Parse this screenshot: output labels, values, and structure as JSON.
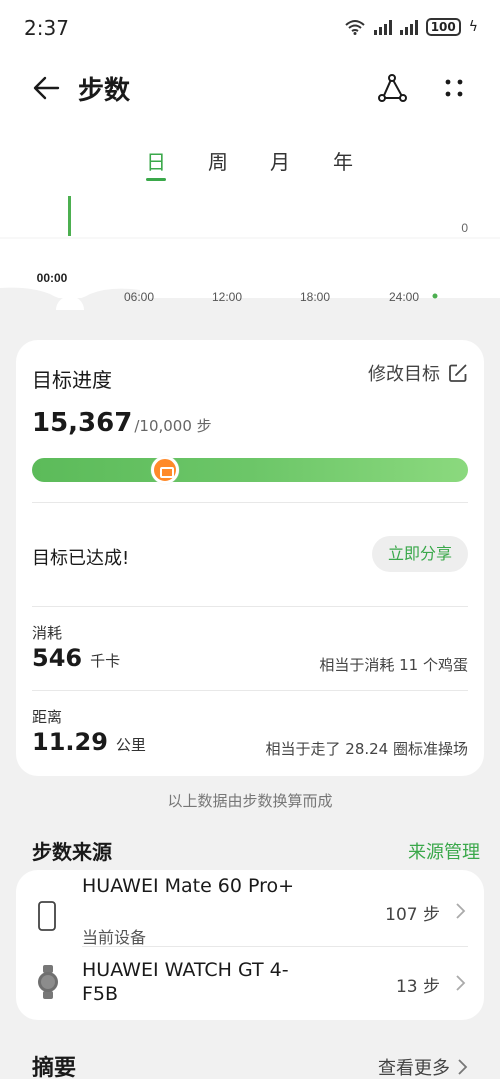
{
  "status_bar": {
    "time": "2:37",
    "battery": "100"
  },
  "header": {
    "title": "步数"
  },
  "tabs": [
    {
      "label": "日",
      "active": true
    },
    {
      "label": "周",
      "active": false
    },
    {
      "label": "月",
      "active": false
    },
    {
      "label": "年",
      "active": false
    }
  ],
  "chart": {
    "y_label": "0",
    "x_labels": [
      "00:00",
      "06:00",
      "12:00",
      "18:00",
      "24:00"
    ]
  },
  "goal_card": {
    "title": "目标进度",
    "edit_label": "修改目标",
    "steps": "15,367",
    "goal_text": "/10,000 步",
    "progress": 1.0,
    "achieved_text": "目标已达成!",
    "share_label": "立即分享",
    "calories": {
      "label": "消耗",
      "value": "546",
      "unit": "千卡",
      "equivalent": "相当于消耗 11 个鸡蛋"
    },
    "distance": {
      "label": "距离",
      "value": "11.29",
      "unit": "公里",
      "equivalent": "相当于走了 28.24 圈标准操场"
    }
  },
  "note": "以上数据由步数换算而成",
  "sources": {
    "title": "步数来源",
    "manage_label": "来源管理",
    "items": [
      {
        "name": "HUAWEI Mate 60 Pro+",
        "sub": "当前设备",
        "steps": "107 步",
        "icon": "phone-icon"
      },
      {
        "name": "HUAWEI WATCH GT 4-F5B",
        "steps": "13 步",
        "icon": "watch-icon"
      }
    ]
  },
  "summary": {
    "title": "摘要",
    "more_label": "查看更多"
  },
  "colors": {
    "accent": "#3aa84a",
    "marker": "#ff8a2a",
    "background": "#f1f1f1"
  }
}
